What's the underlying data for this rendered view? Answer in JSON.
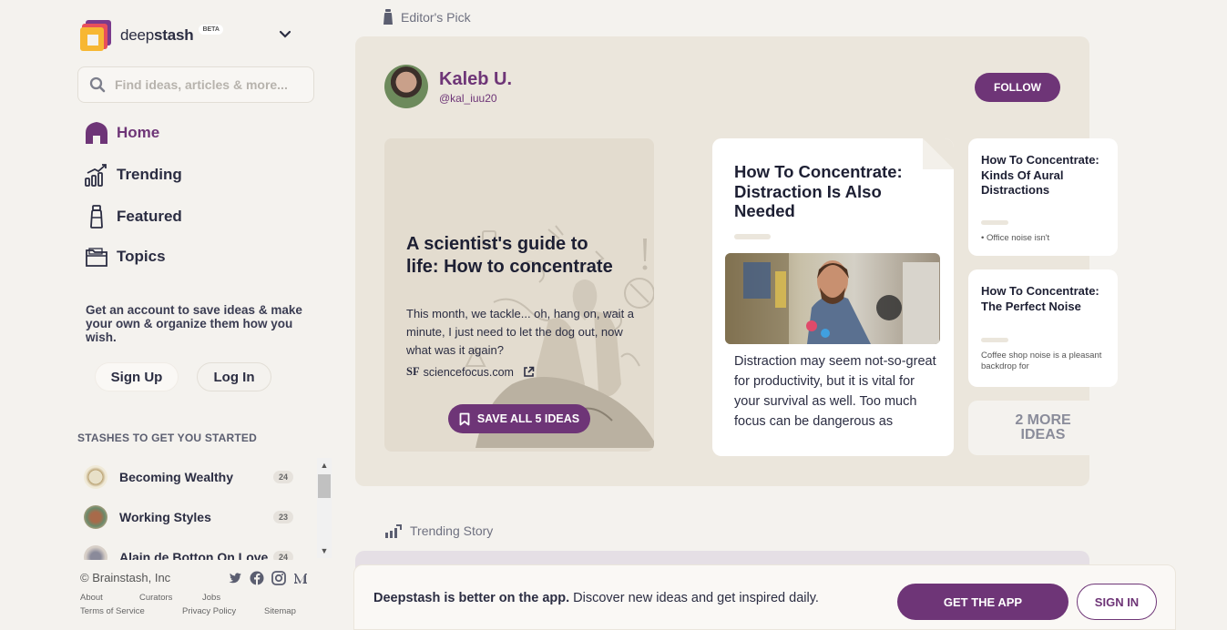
{
  "brand": {
    "name_light": "deep",
    "name_bold": "stash",
    "badge": "BETA"
  },
  "search": {
    "placeholder": "Find ideas, articles & more..."
  },
  "nav": [
    {
      "label": "Home",
      "icon": "home-icon",
      "active": true
    },
    {
      "label": "Trending",
      "icon": "trending-icon"
    },
    {
      "label": "Featured",
      "icon": "bottle-icon"
    },
    {
      "label": "Topics",
      "icon": "folder-icon"
    }
  ],
  "promo": {
    "text": "Get an account to save ideas & make your own & organize them how you wish."
  },
  "auth": {
    "signup": "Sign Up",
    "login": "Log In"
  },
  "stashes": {
    "title": "STASHES TO GET YOU STARTED",
    "items": [
      {
        "name": "Becoming Wealthy",
        "count": "24"
      },
      {
        "name": "Working Styles",
        "count": "23"
      },
      {
        "name": "Alain de Botton On Love",
        "count": "24"
      }
    ]
  },
  "footer": {
    "copyright": "© Brainstash, Inc",
    "links": [
      "About",
      "Curators",
      "Jobs",
      "Terms of Service",
      "Privacy Policy",
      "Sitemap"
    ],
    "socials": [
      "twitter-icon",
      "facebook-icon",
      "instagram-icon",
      "medium-icon"
    ]
  },
  "editors_pick": {
    "label": "Editor's Pick",
    "author": {
      "name": "Kaleb U.",
      "handle": "@kal_iuu20"
    },
    "follow": "FOLLOW",
    "article": {
      "title": "A scientist's guide to life: How to concentrate",
      "summary": "This month, we tackle... oh, hang on, wait a minute, I just need to let the dog out, now what was it again?",
      "source_logo": "SF",
      "source": "sciencefocus.com",
      "save_all": "SAVE ALL 5 IDEAS"
    },
    "main_idea": {
      "title": "How To Concentrate: Distraction Is Also Needed",
      "text": "Distraction may seem not-so-great for productivity, but it is vital for your survival as well. Too much focus can be dangerous as"
    },
    "side_ideas": [
      {
        "title": "How To Concentrate: Kinds Of Aural Distractions",
        "text": "Office noise isn't"
      },
      {
        "title": "How To Concentrate: The Perfect Noise",
        "text": "Coffee shop noise is a pleasant backdrop for"
      }
    ],
    "more": {
      "line1": "2 MORE",
      "line2": "IDEAS"
    }
  },
  "trending": {
    "label": "Trending Story"
  },
  "app_banner": {
    "bold": "Deepstash is better on the app.",
    "rest": " Discover new ideas and get inspired daily.",
    "get_app": "GET THE APP",
    "sign_in": "SIGN IN"
  },
  "colors": {
    "accent": "#6e3577",
    "background": "#f4f2ee",
    "card": "#ebe6dc"
  }
}
